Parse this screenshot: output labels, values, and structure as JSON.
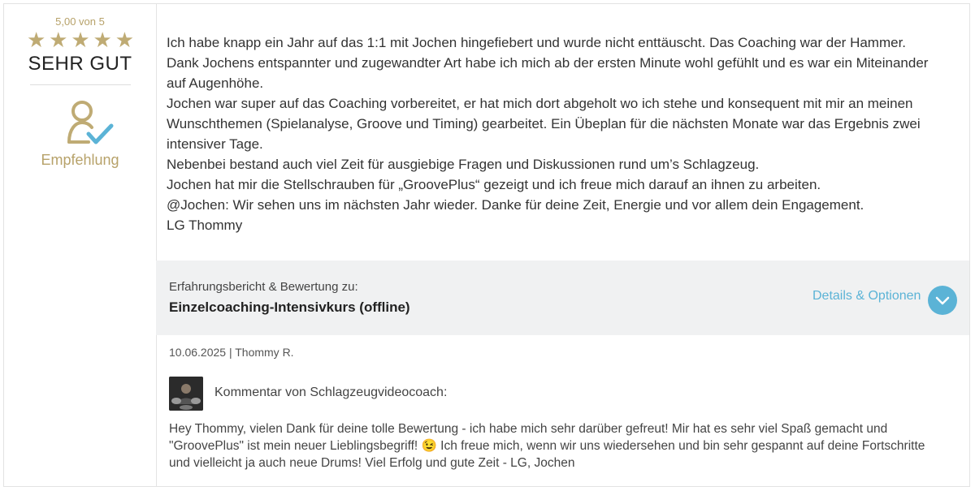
{
  "rating": {
    "score_text": "5,00 von 5",
    "stars": 5,
    "stars_max": 5,
    "grade": "SEHR GUT",
    "recommendation": "Empfehlung",
    "accent_color": "#bfab74"
  },
  "review": {
    "lines": [
      "Ich habe knapp ein Jahr auf das 1:1 mit Jochen hingefiebert und wurde nicht enttäuscht. Das Coaching war der Hammer.",
      "Dank Jochens entspannter und zugewandter Art habe ich mich ab der ersten Minute wohl gefühlt und es war ein Miteinander auf Augenhöhe.",
      "Jochen war super auf das Coaching vorbereitet, er hat mich dort abgeholt wo ich stehe und konsequent mit mir an meinen Wunschthemen (Spielanalyse, Groove und Timing) gearbeitet. Ein Übeplan für die nächsten Monate war das Ergebnis zwei intensiver Tage.",
      "Nebenbei bestand auch viel Zeit für ausgiebige Fragen und Diskussionen rund um’s Schlagzeug.",
      "Jochen hat mir die Stellschrauben für „GroovePlus“ gezeigt und ich freue mich darauf an ihnen zu arbeiten.",
      "@Jochen: Wir sehen uns im nächsten Jahr wieder. Danke für deine Zeit, Energie und vor allem dein Engagement.",
      "LG Thommy"
    ]
  },
  "course": {
    "label": "Erfahrungsbericht & Bewertung zu:",
    "title": "Einzelcoaching-Intensivkurs (offline)",
    "details_label": "Details & Optionen",
    "link_color": "#5bb3d6"
  },
  "meta": {
    "date_author": "10.06.2025 | Thommy R."
  },
  "reply": {
    "heading": "Kommentar von Schlagzeugvideocoach:",
    "text": "Hey Thommy, vielen Dank für deine tolle Bewertung - ich habe mich sehr darüber gefreut! Mir hat es sehr viel Spaß gemacht und \"GroovePlus\" ist mein neuer Lieblingsbegriff! 😉 Ich freue mich, wenn wir uns wiedersehen und bin sehr gespannt auf deine Fortschritte und vielleicht ja auch neue Drums! Viel Erfolg und gute Zeit - LG, Jochen"
  },
  "icons": {
    "star": "star-icon",
    "recommendation": "user-check-icon",
    "details": "chevron-down-icon",
    "avatar": "coach-avatar"
  }
}
